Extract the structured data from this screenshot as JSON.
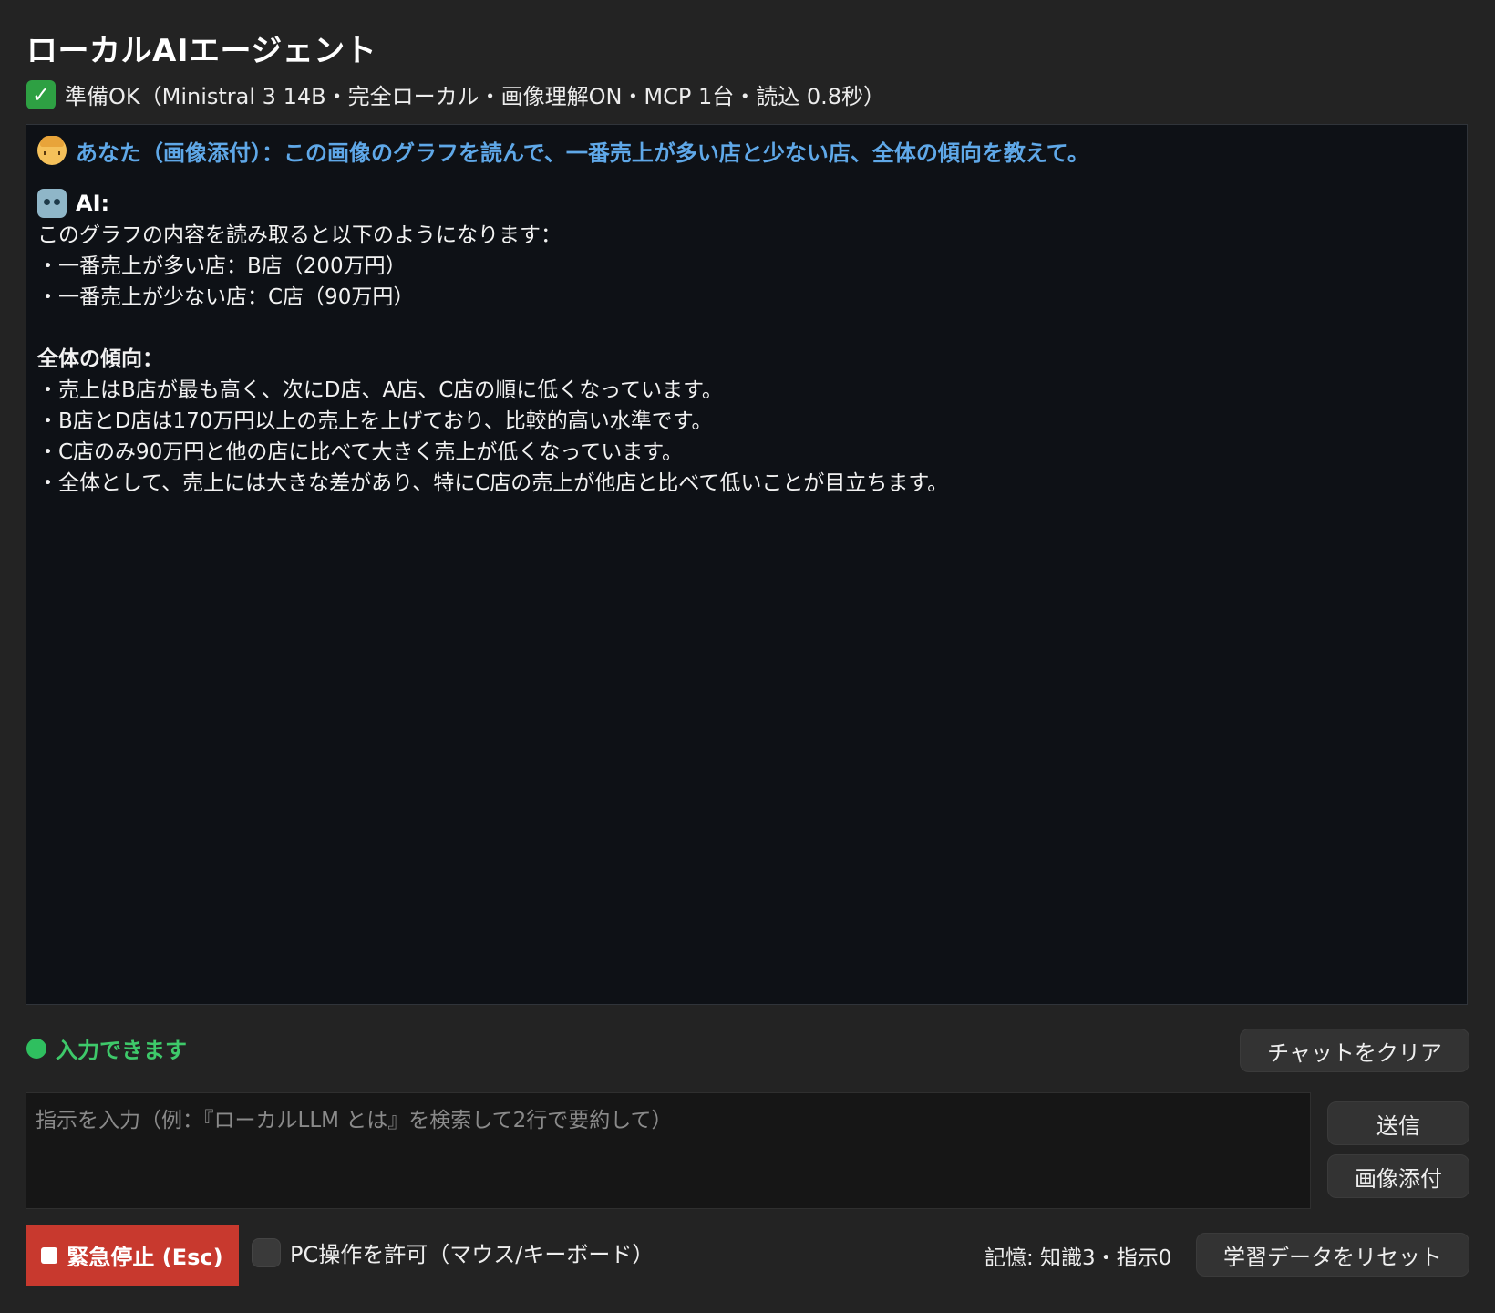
{
  "app": {
    "title": "ローカルAIエージェント",
    "status": "準備OK（Ministral 3 14B・完全ローカル・画像理解ON・MCP 1台・読込 0.8秒）",
    "status_icon": "check-mark-icon"
  },
  "chat": {
    "user": {
      "icon": "person-emoji-icon",
      "text": "あなた（画像添付）：この画像のグラフを読んで、一番売上が多い店と少ない店、全体の傾向を教えて。"
    },
    "ai": {
      "icon": "robot-emoji-icon",
      "label": "AI:",
      "intro": "このグラフの内容を読み取ると以下のようになります：",
      "line1": "・一番売上が多い店：B店（200万円）",
      "line2": "・一番売上が少ない店：C店（90万円）",
      "trend_heading": "全体の傾向：",
      "trend1": "・売上はB店が最も高く、次にD店、A店、C店の順に低くなっています。",
      "trend2": "・B店とD店は170万円以上の売上を上げており、比較的高い水準です。",
      "trend3": "・C店のみ90万円と他の店に比べて大きく売上が低くなっています。",
      "trend4": "・全体として、売上には大きな差があり、特にC店の売上が他店と比べて低いことが目立ちます。"
    }
  },
  "input_status": {
    "text": "入力できます",
    "color": "#3ec96a"
  },
  "buttons": {
    "clear": "チャットをクリア",
    "send": "送信",
    "attach": "画像添付",
    "stop": "緊急停止 (Esc)",
    "reset": "学習データをリセット"
  },
  "input": {
    "placeholder": "指示を入力（例：『ローカルLLM とは』を検索して2行で要約して）",
    "value": ""
  },
  "pc_control": {
    "label": "PC操作を許可（マウス/キーボード）",
    "checked": false
  },
  "memory": {
    "text": "記憶: 知識3・指示0"
  },
  "colors": {
    "background": "#232323",
    "chat_background": "#0e1116",
    "user_text": "#5fa8e8",
    "stop_button": "#c8392e"
  }
}
